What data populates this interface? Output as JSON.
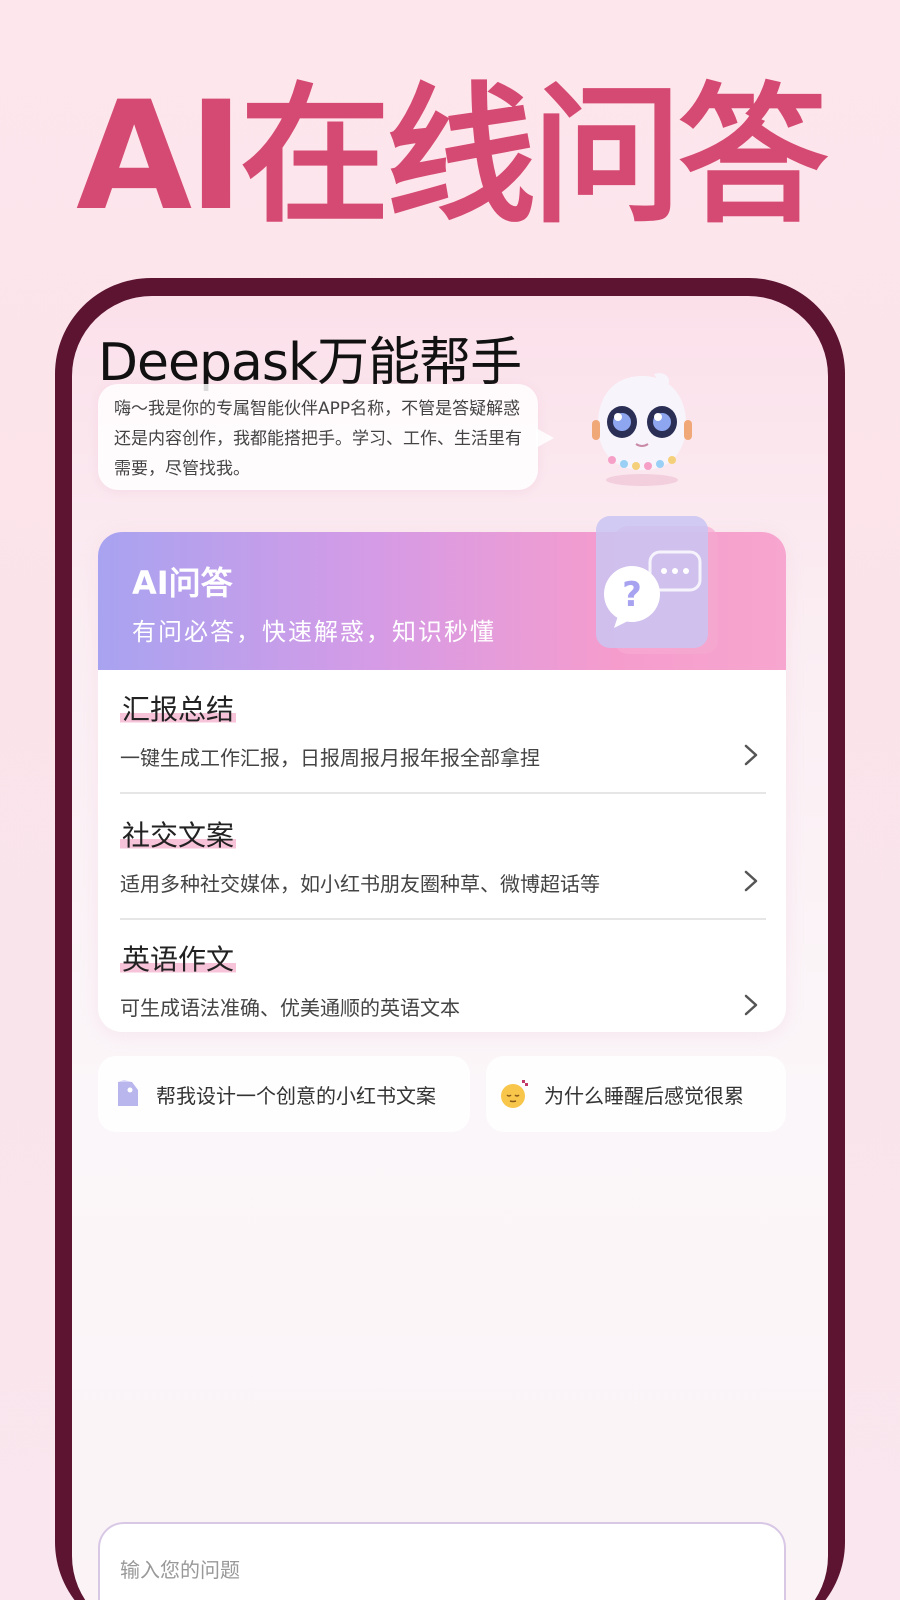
{
  "hero": {
    "title": "AI在线问答"
  },
  "app": {
    "title": "Deepask万能帮手",
    "intro": "嗨～我是你的专属智能伙伴APP名称，不管是答疑解惑还是内容创作，我都能搭把手。学习、工作、生活里有需要，尽管找我。"
  },
  "qa_card": {
    "title": "AI问答",
    "subtitle": "有问必答，快速解惑，知识秒懂",
    "items": [
      {
        "title": "汇报总结",
        "desc": "一键生成工作汇报，日报周报月报年报全部拿捏"
      },
      {
        "title": "社交文案",
        "desc": "适用多种社交媒体，如小红书朋友圈种草、微博超话等"
      },
      {
        "title": "英语作文",
        "desc": "可生成语法准确、优美通顺的英语文本"
      }
    ]
  },
  "suggestions": [
    {
      "label": "帮我设计一个创意的小红书文案",
      "icon": "tag-icon"
    },
    {
      "label": "为什么睡醒后感觉很累",
      "icon": "sleepy-face-icon"
    }
  ],
  "input": {
    "placeholder": "输入您的问题"
  },
  "colors": {
    "hero_title": "#d54a72",
    "frame": "#5c1431",
    "highlight": "#f7c3d8",
    "header_gradient_start": "#a8a3f0",
    "header_gradient_end": "#f7a6cf"
  }
}
